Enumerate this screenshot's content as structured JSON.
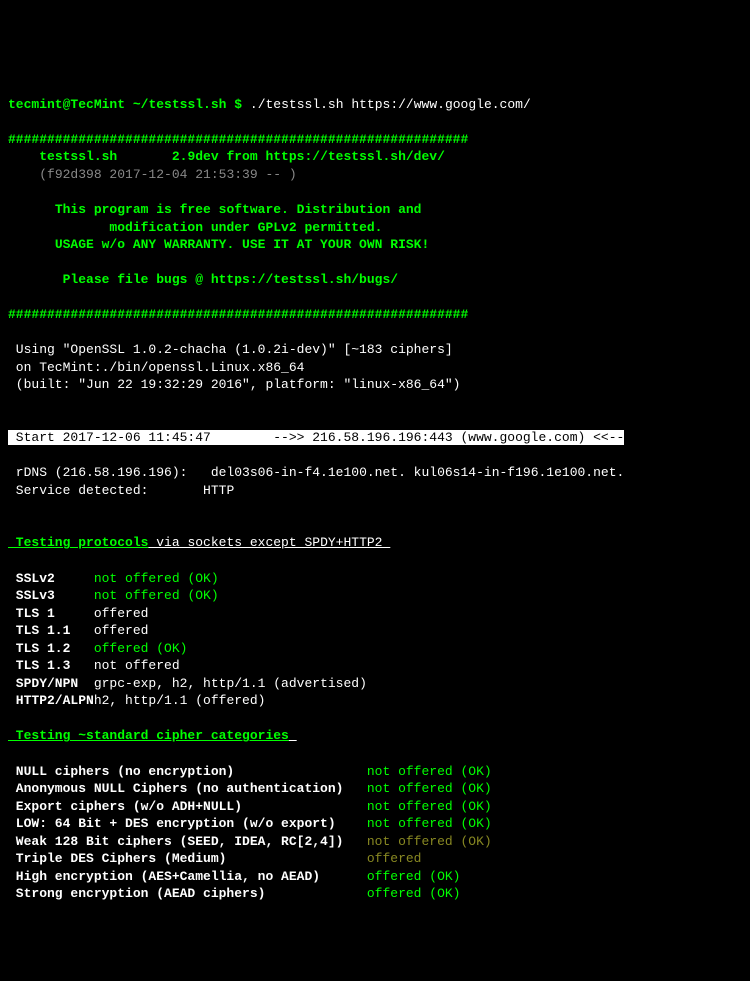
{
  "prompt": {
    "user": "tecmint@TecMint",
    "path": "~/testssl.sh",
    "symbol": "$",
    "command": "./testssl.sh https://www.google.com/"
  },
  "header": {
    "hashline": "###########################################################",
    "program": "testssl.sh",
    "version": "2.9dev from https://testssl.sh/dev/",
    "commit": "(f92d398 2017-12-04 21:53:39 -- )",
    "desc1": "This program is free software. Distribution and",
    "desc2": "modification under GPLv2 permitted.",
    "desc3": "USAGE w/o ANY WARRANTY. USE IT AT YOUR OWN RISK!",
    "bugs": "Please file bugs @ https://testssl.sh/bugs/"
  },
  "using": {
    "line1": " Using \"OpenSSL 1.0.2-chacha (1.0.2i-dev)\" [~183 ciphers]",
    "line2": " on TecMint:./bin/openssl.Linux.x86_64",
    "line3": " (built: \"Jun 22 19:32:29 2016\", platform: \"linux-x86_64\")"
  },
  "start": {
    "line": " Start 2017-12-06 11:45:47        -->> 216.58.196.196:443 (www.google.com) <<--"
  },
  "rdns": {
    "label": " rDNS (216.58.196.196):",
    "value": "del03s06-in-f4.1e100.net. kul06s14-in-f196.1e100.net.",
    "service_label": " Service detected:",
    "service_value": "HTTP"
  },
  "protocols": {
    "heading_left": " Testing protocols",
    "heading_right": " via sockets except SPDY+HTTP2",
    "rows": [
      {
        "name": " SSLv2",
        "value": "not offered (OK)",
        "color": "green"
      },
      {
        "name": " SSLv3",
        "value": "not offered (OK)",
        "color": "green"
      },
      {
        "name": " TLS 1",
        "value": "offered",
        "color": "white"
      },
      {
        "name": " TLS 1.1",
        "value": "offered",
        "color": "white"
      },
      {
        "name": " TLS 1.2",
        "value": "offered (OK)",
        "color": "green"
      },
      {
        "name": " TLS 1.3",
        "value": "not offered",
        "color": "white"
      },
      {
        "name": " SPDY/NPN",
        "value": "grpc-exp, h2, http/1.1 (advertised)",
        "color": "white"
      },
      {
        "name": " HTTP2/ALPN",
        "value": "h2, http/1.1 (offered)",
        "color": "white"
      }
    ]
  },
  "ciphers": {
    "heading": " Testing ~standard cipher categories",
    "rows": [
      {
        "name": " NULL ciphers (no encryption)",
        "value": "not offered (OK)",
        "color": "green"
      },
      {
        "name": " Anonymous NULL Ciphers (no authentication)",
        "value": "not offered (OK)",
        "color": "green"
      },
      {
        "name": " Export ciphers (w/o ADH+NULL)",
        "value": "not offered (OK)",
        "color": "green"
      },
      {
        "name": " LOW: 64 Bit + DES encryption (w/o export)",
        "value": "not offered (OK)",
        "color": "green"
      },
      {
        "name": " Weak 128 Bit ciphers (SEED, IDEA, RC[2,4])",
        "value": "not offered (OK)",
        "color": "yellow-dim"
      },
      {
        "name": " Triple DES Ciphers (Medium)",
        "value": "offered",
        "color": "yellow-dim"
      },
      {
        "name": " High encryption (AES+Camellia, no AEAD)",
        "value": "offered (OK)",
        "color": "green"
      },
      {
        "name": " Strong encryption (AEAD ciphers)",
        "value": "offered (OK)",
        "color": "green"
      }
    ]
  }
}
